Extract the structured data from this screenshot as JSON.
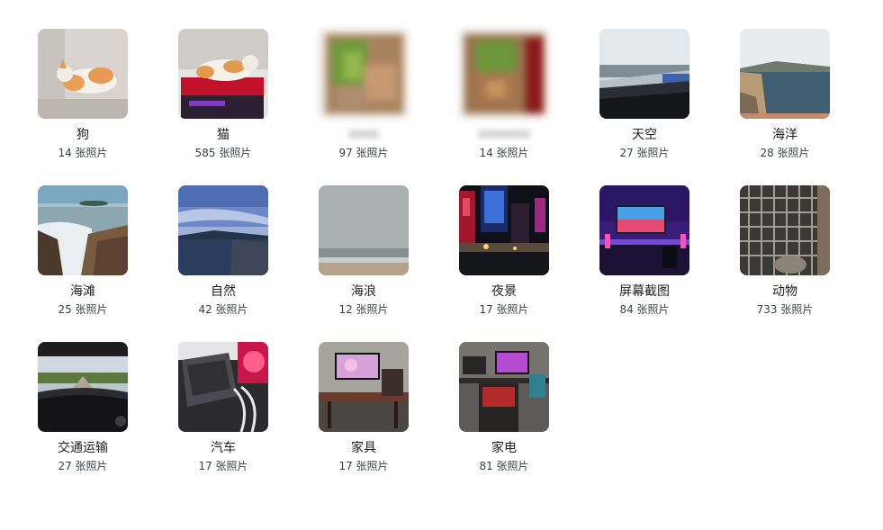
{
  "categories": [
    {
      "label": "狗",
      "count": "14 张照片",
      "icon": "dog-photo",
      "blurred": false
    },
    {
      "label": "猫",
      "count": "585 张照片",
      "icon": "cat-photo",
      "blurred": false
    },
    {
      "label": "",
      "count": "97 张照片",
      "icon": "food-photo",
      "blurred": true
    },
    {
      "label": "",
      "count": "14 张照片",
      "icon": "food-photo",
      "blurred": true
    },
    {
      "label": "天空",
      "count": "27 张照片",
      "icon": "sky-photo",
      "blurred": false
    },
    {
      "label": "海洋",
      "count": "28 张照片",
      "icon": "ocean-photo",
      "blurred": false
    },
    {
      "label": "海滩",
      "count": "25 张照片",
      "icon": "beach-photo",
      "blurred": false
    },
    {
      "label": "自然",
      "count": "42 张照片",
      "icon": "nature-photo",
      "blurred": false
    },
    {
      "label": "海浪",
      "count": "12 张照片",
      "icon": "waves-photo",
      "blurred": false
    },
    {
      "label": "夜景",
      "count": "17 张照片",
      "icon": "night-photo",
      "blurred": false
    },
    {
      "label": "屏幕截图",
      "count": "84 张照片",
      "icon": "screenshot-photo",
      "blurred": false
    },
    {
      "label": "动物",
      "count": "733 张照片",
      "icon": "animal-photo",
      "blurred": false
    },
    {
      "label": "交通运输",
      "count": "27 张照片",
      "icon": "transport-photo",
      "blurred": false
    },
    {
      "label": "汽车",
      "count": "17 张照片",
      "icon": "car-photo",
      "blurred": false
    },
    {
      "label": "家具",
      "count": "17 张照片",
      "icon": "furniture-photo",
      "blurred": false
    },
    {
      "label": "家电",
      "count": "81 张照片",
      "icon": "appliance-photo",
      "blurred": false
    }
  ]
}
